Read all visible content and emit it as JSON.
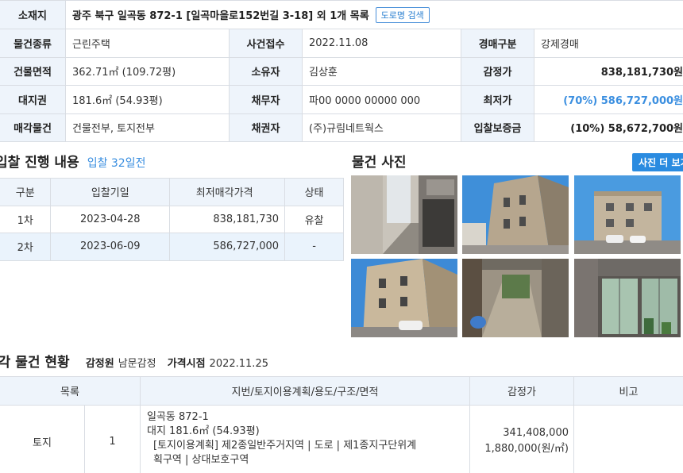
{
  "summary": {
    "address_label": "소재지",
    "address": "광주 북구 일곡동 872-1 [일곡마을로152번길 3-18] 외 1개 목록",
    "road_search_button": "도로명 검색",
    "rows": [
      {
        "l1": "물건종류",
        "v1": "근린주택",
        "l2": "사건접수",
        "v2": "2022.11.08",
        "l3": "경매구분",
        "v3": "강제경매"
      },
      {
        "l1": "건물면적",
        "v1": "362.71㎡ (109.72평)",
        "l2": "소유자",
        "v2": "김상훈",
        "l3": "감정가",
        "v3": "838,181,730원"
      },
      {
        "l1": "대지권",
        "v1": "181.6㎡ (54.93평)",
        "l2": "채무자",
        "v2": "파00 0000 00000 000",
        "l3": "최저가",
        "v3": "(70%) 586,727,000원"
      },
      {
        "l1": "매각물건",
        "v1": "건물전부, 토지전부",
        "l2": "채권자",
        "v2": "(주)규림네트웍스",
        "l3": "입찰보증금",
        "v3": "(10%) 58,672,700원"
      }
    ]
  },
  "bid_section": {
    "title": "입찰 진행 내용",
    "subtitle": "입찰 32일전",
    "headers": [
      "구분",
      "입찰기일",
      "최저매각가격",
      "상태"
    ],
    "rows": [
      {
        "round": "1차",
        "date": "2023-04-28",
        "price": "838,181,730",
        "status": "유찰"
      },
      {
        "round": "2차",
        "date": "2023-06-09",
        "price": "586,727,000",
        "status": "-"
      }
    ]
  },
  "photo_section": {
    "title": "물건 사진",
    "more_button": "사진 더 보기"
  },
  "status_section": {
    "title": "매각 물건 현황",
    "appraiser_label": "감정원",
    "appraiser": "남문감정",
    "price_date_label": "가격시점",
    "price_date": "2022.11.25",
    "headers": [
      "목록",
      "지번/토지이용계획/용도/구조/면적",
      "감정가",
      "비고"
    ],
    "row": {
      "type": "토지",
      "no": "1",
      "line1": "일곡동 872-1",
      "line2": "대지 181.6㎡ (54.93평)",
      "line3": "[토지이용계획] 제2종일반주거지역 | 도로 | 제1종지구단위계",
      "line4": "획구역 | 상대보호구역",
      "price": "341,408,000",
      "unit_price": "1,880,000(원/㎡)",
      "note": ""
    }
  },
  "colors": {
    "accent": "#2a8be0",
    "header_bg": "#eef4fb",
    "border": "#d9dde3"
  }
}
